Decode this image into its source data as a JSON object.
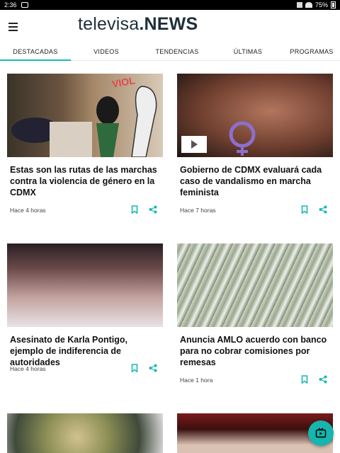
{
  "status_bar": {
    "time": "2:36",
    "battery": "75%"
  },
  "app_bar": {
    "logo_brand": "televisa",
    "logo_news": ".NEWS"
  },
  "tabs": [
    {
      "label": "DESTACADAS",
      "active": true
    },
    {
      "label": "VIDEOS",
      "active": false
    },
    {
      "label": "TENDENCIAS",
      "active": false
    },
    {
      "label": "ÚLTIMAS",
      "active": false
    },
    {
      "label": "PROGRAMAS",
      "active": false
    }
  ],
  "articles": [
    {
      "headline": "Estas son las rutas de las marchas contra la violencia de género en la CDMX",
      "time": "Hace 4 horas",
      "has_video": false
    },
    {
      "headline": "Gobierno de CDMX evaluará cada caso de vandalismo en marcha feminista",
      "time": "Hace 7 horas",
      "has_video": true
    },
    {
      "headline": "Asesinato de Karla Pontigo, ejemplo de indiferencia de autoridades",
      "time": "Hace 4 horas",
      "has_video": false
    },
    {
      "headline": "Anuncia AMLO acuerdo con banco para no cobrar comisiones por remesas",
      "time": "Hace 1 hora",
      "has_video": false
    }
  ],
  "image_text": {
    "mural_word": "VIOL"
  },
  "icons": {
    "menu": "menu-icon",
    "bookmark": "bookmark-icon",
    "share": "share-icon",
    "play": "play-icon",
    "fab": "live-tv-icon"
  },
  "colors": {
    "accent": "#17b9b1",
    "logo": "#1f2f3a"
  }
}
